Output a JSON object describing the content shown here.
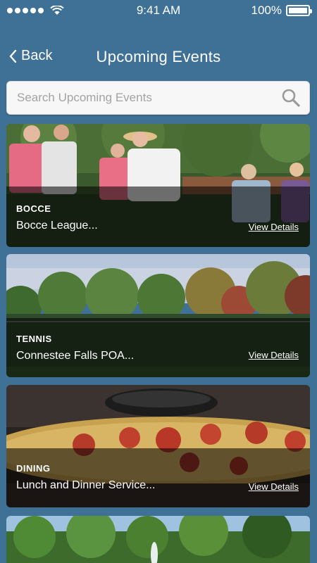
{
  "status_bar": {
    "time": "9:41 AM",
    "battery": "100%",
    "battery_level": 1.0,
    "signal_icon": "signal-dots-icon",
    "wifi_icon": "wifi-icon"
  },
  "nav": {
    "back_label": "Back",
    "title": "Upcoming Events"
  },
  "search": {
    "placeholder": "Search Upcoming Events"
  },
  "events": [
    {
      "category": "BOCCE",
      "title": "Bocce League...",
      "link": "View Details"
    },
    {
      "category": "TENNIS",
      "title": "Connestee Falls POA...",
      "link": "View Details"
    },
    {
      "category": "DINING",
      "title": "Lunch and Dinner Service...",
      "link": "View Details"
    }
  ],
  "colors": {
    "background": "#3f7196",
    "search_bg": "#f7f7f7",
    "overlay": "rgba(0,0,0,0.55)"
  }
}
